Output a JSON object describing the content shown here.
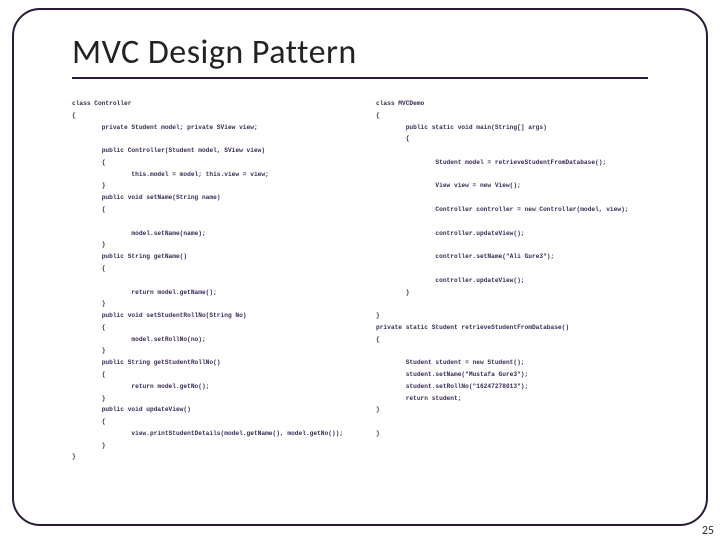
{
  "title": "MVC Design Pattern",
  "page_number": "25",
  "code_left": "class Controller\n{\n        private Student model; private SView view;\n\n        public Controller(Student model, SView view)\n        {\n                this.model = model; this.view = view;\n        }\n        public void setName(String name)\n        {\n\n                model.setName(name);\n        }\n        public String getName()\n        {\n\n                return model.getName();\n        }\n        public void setStudentRollNo(String No)\n        {\n                model.setRollNo(no);\n        }\n        public String getStudentRollNo()\n        {\n                return model.getNo();\n        }\n        public void updateView()\n        {\n                view.printStudentDetails(model.getName(), model.getNo());\n        }\n}",
  "code_right": "class MVCDemo\n{\n        public static void main(String[] args)\n        {\n\n                Student model = retrieveStudentFromDatabase();\n\n                View view = new View();\n\n                Controller controller = new Controller(model, view);\n\n                controller.updateView();\n\n                controller.setName(\"Ali Gure3\");\n\n                controller.updateView();\n        }\n\n}\nprivate static Student retrieveStudentFromDatabase()\n{\n\n        Student student = new Student();\n        student.setName(\"Mustafa Gure3\");\n        student.setRollNo(\"16247278013\");\n        return student;\n}\n\n}"
}
